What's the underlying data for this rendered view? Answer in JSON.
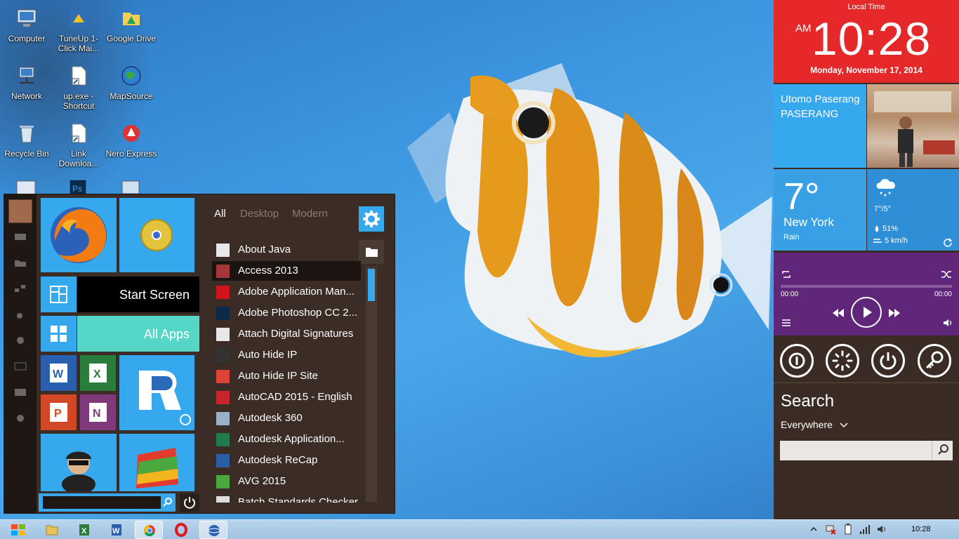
{
  "desktop": {
    "icons": [
      {
        "label": "Computer"
      },
      {
        "label": "TuneUp 1-Click Mai..."
      },
      {
        "label": "Google Drive"
      },
      {
        "label": "Network"
      },
      {
        "label": "up.exe - Shortcut"
      },
      {
        "label": "MapSource"
      },
      {
        "label": "Recycle Bin"
      },
      {
        "label": "Link Downloa..."
      },
      {
        "label": "Nero Express"
      }
    ]
  },
  "start_menu": {
    "tiles": {
      "start_screen": "Start Screen",
      "all_apps": "All Apps"
    },
    "tabs": [
      "All",
      "Desktop",
      "Modern"
    ],
    "apps": [
      {
        "label": "About Java",
        "icon": "java-icon"
      },
      {
        "label": "Access 2013",
        "icon": "access-icon"
      },
      {
        "label": "Adobe Application Man...",
        "icon": "adobe-icon"
      },
      {
        "label": "Adobe Photoshop CC 2...",
        "icon": "photoshop-icon"
      },
      {
        "label": "Attach Digital Signatures",
        "icon": "signature-icon"
      },
      {
        "label": "Auto Hide IP",
        "icon": "user-icon"
      },
      {
        "label": "Auto Hide IP Site",
        "icon": "chrome-icon"
      },
      {
        "label": "AutoCAD 2015 - English",
        "icon": "autocad-icon"
      },
      {
        "label": "Autodesk 360",
        "icon": "autodesk360-icon"
      },
      {
        "label": "Autodesk Application...",
        "icon": "autodesk-icon"
      },
      {
        "label": "Autodesk ReCap",
        "icon": "recap-icon"
      },
      {
        "label": "AVG 2015",
        "icon": "avg-icon"
      },
      {
        "label": "Batch Standards Checker",
        "icon": "checker-icon"
      }
    ]
  },
  "sidebar": {
    "clock": {
      "header": "Local Time",
      "ampm": "AM",
      "time": "10:28",
      "date": "Monday, November 17, 2014"
    },
    "user": {
      "name": "Utomo Paserang",
      "surname": "PASERANG"
    },
    "weather": {
      "temp": "7°",
      "city": "New York",
      "condition": "Rain",
      "range": "7°/5°",
      "humidity": "51%",
      "wind": "5 km/h"
    },
    "music": {
      "elapsed": "00:00",
      "total": "00:00"
    },
    "search": {
      "title": "Search",
      "scope": "Everywhere"
    }
  },
  "taskbar": {
    "time": "10:28"
  },
  "colors": {
    "accent_blue": "#35a8ee",
    "clock_red": "#e5282a",
    "music_purple": "#5f2679",
    "menu_brown": "#3b2d25"
  }
}
